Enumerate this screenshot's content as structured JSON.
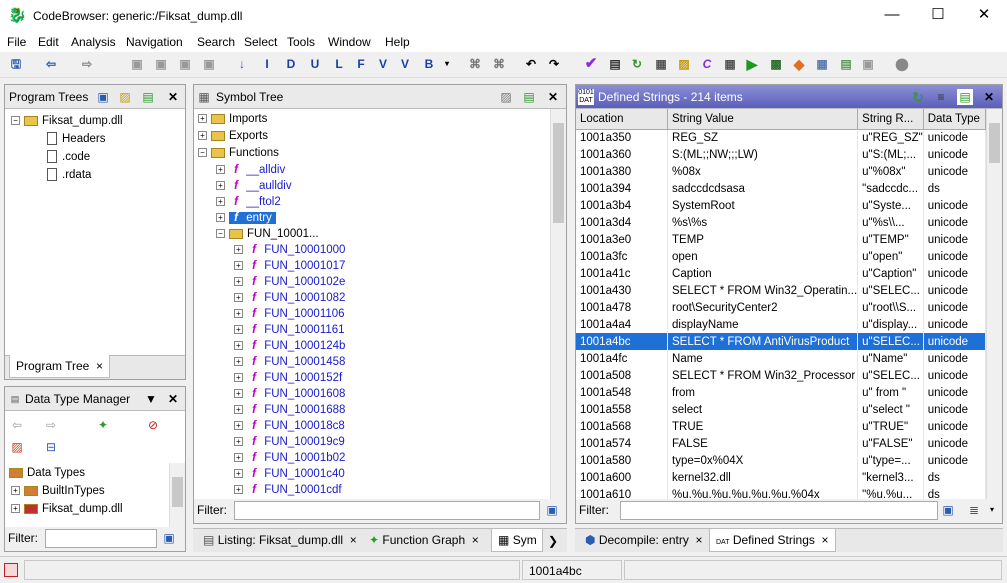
{
  "window": {
    "title": "CodeBrowser: generic:/Fiksat_dump.dll"
  },
  "menu": [
    "File",
    "Edit",
    "Analysis",
    "Navigation",
    "Search",
    "Select",
    "Tools",
    "Window",
    "Help"
  ],
  "toolbar_letters": [
    "I",
    "D",
    "U",
    "L",
    "F",
    "V",
    "V",
    "B"
  ],
  "program_trees": {
    "title": "Program Trees",
    "root": "Fiksat_dump.dll",
    "children": [
      "Headers",
      ".code",
      ".rdata"
    ],
    "tab": "Program Tree"
  },
  "data_type_manager": {
    "title": "Data Type Manager",
    "root": "Data Types",
    "items": [
      "BuiltInTypes",
      "Fiksat_dump.dll"
    ],
    "filter_label": "Filter:"
  },
  "symbol_tree": {
    "title": "Symbol Tree",
    "top": [
      "Imports",
      "Exports",
      "Functions"
    ],
    "functions": [
      "__alldiv",
      "__aulldiv",
      "__ftol2",
      "entry"
    ],
    "group": "FUN_10001...",
    "fun_items": [
      "FUN_10001000",
      "FUN_10001017",
      "FUN_1000102e",
      "FUN_10001082",
      "FUN_10001106",
      "FUN_10001161",
      "FUN_1000124b",
      "FUN_10001458",
      "FUN_1000152f",
      "FUN_10001608",
      "FUN_10001688",
      "FUN_100018c8",
      "FUN_100019c9",
      "FUN_10001b02",
      "FUN_10001c40",
      "FUN_10001cdf"
    ],
    "filter_label": "Filter:"
  },
  "defined_strings": {
    "title": "Defined Strings - 214 items",
    "columns": [
      "Location",
      "String Value",
      "String R...",
      "Data Type"
    ],
    "rows": [
      [
        "1001a350",
        "REG_SZ",
        "u\"REG_SZ\"",
        "unicode"
      ],
      [
        "1001a360",
        "S:(ML;;NW;;;LW)",
        "u\"S:(ML;...",
        "unicode"
      ],
      [
        "1001a380",
        "%08x",
        "u\"%08x\"",
        "unicode"
      ],
      [
        "1001a394",
        "sadccdcdsasa",
        "\"sadccdc...",
        "ds"
      ],
      [
        "1001a3b4",
        "SystemRoot",
        "u\"Syste...",
        "unicode"
      ],
      [
        "1001a3d4",
        "%s\\%s",
        "u\"%s\\\\...",
        "unicode"
      ],
      [
        "1001a3e0",
        "TEMP",
        "u\"TEMP\"",
        "unicode"
      ],
      [
        "1001a3fc",
        "open",
        "u\"open\"",
        "unicode"
      ],
      [
        "1001a41c",
        "Caption",
        "u\"Caption\"",
        "unicode"
      ],
      [
        "1001a430",
        "SELECT * FROM Win32_Operatin...",
        "u\"SELEC...",
        "unicode"
      ],
      [
        "1001a478",
        "root\\SecurityCenter2",
        "u\"root\\\\S...",
        "unicode"
      ],
      [
        "1001a4a4",
        "displayName",
        "u\"display...",
        "unicode"
      ],
      [
        "1001a4bc",
        "SELECT * FROM AntiVirusProduct",
        "u\"SELEC...",
        "unicode"
      ],
      [
        "1001a4fc",
        "Name",
        "u\"Name\"",
        "unicode"
      ],
      [
        "1001a508",
        "SELECT * FROM Win32_Processor",
        "u\"SELEC...",
        "unicode"
      ],
      [
        "1001a548",
        " from",
        "u\" from \"",
        "unicode"
      ],
      [
        "1001a558",
        "select",
        "u\"select \"",
        "unicode"
      ],
      [
        "1001a568",
        "TRUE",
        "u\"TRUE\"",
        "unicode"
      ],
      [
        "1001a574",
        "FALSE",
        "u\"FALSE\"",
        "unicode"
      ],
      [
        "1001a580",
        "type=0x%04X",
        "u\"type=...",
        "unicode"
      ],
      [
        "1001a600",
        "kernel32.dll",
        "\"kernel3...",
        "ds"
      ],
      [
        "1001a610",
        "%u.%u.%u.%u.%u.%u.%04x",
        "\"%u.%u...",
        "ds"
      ]
    ],
    "selected_row": 12,
    "filter_label": "Filter:"
  },
  "bottom_tabs_left": [
    "Listing:  Fiksat_dump.dll",
    "Function Graph",
    "Sym"
  ],
  "bottom_tabs_right": [
    "Decompile: entry",
    "Defined Strings"
  ],
  "status": {
    "address": "1001a4bc"
  }
}
